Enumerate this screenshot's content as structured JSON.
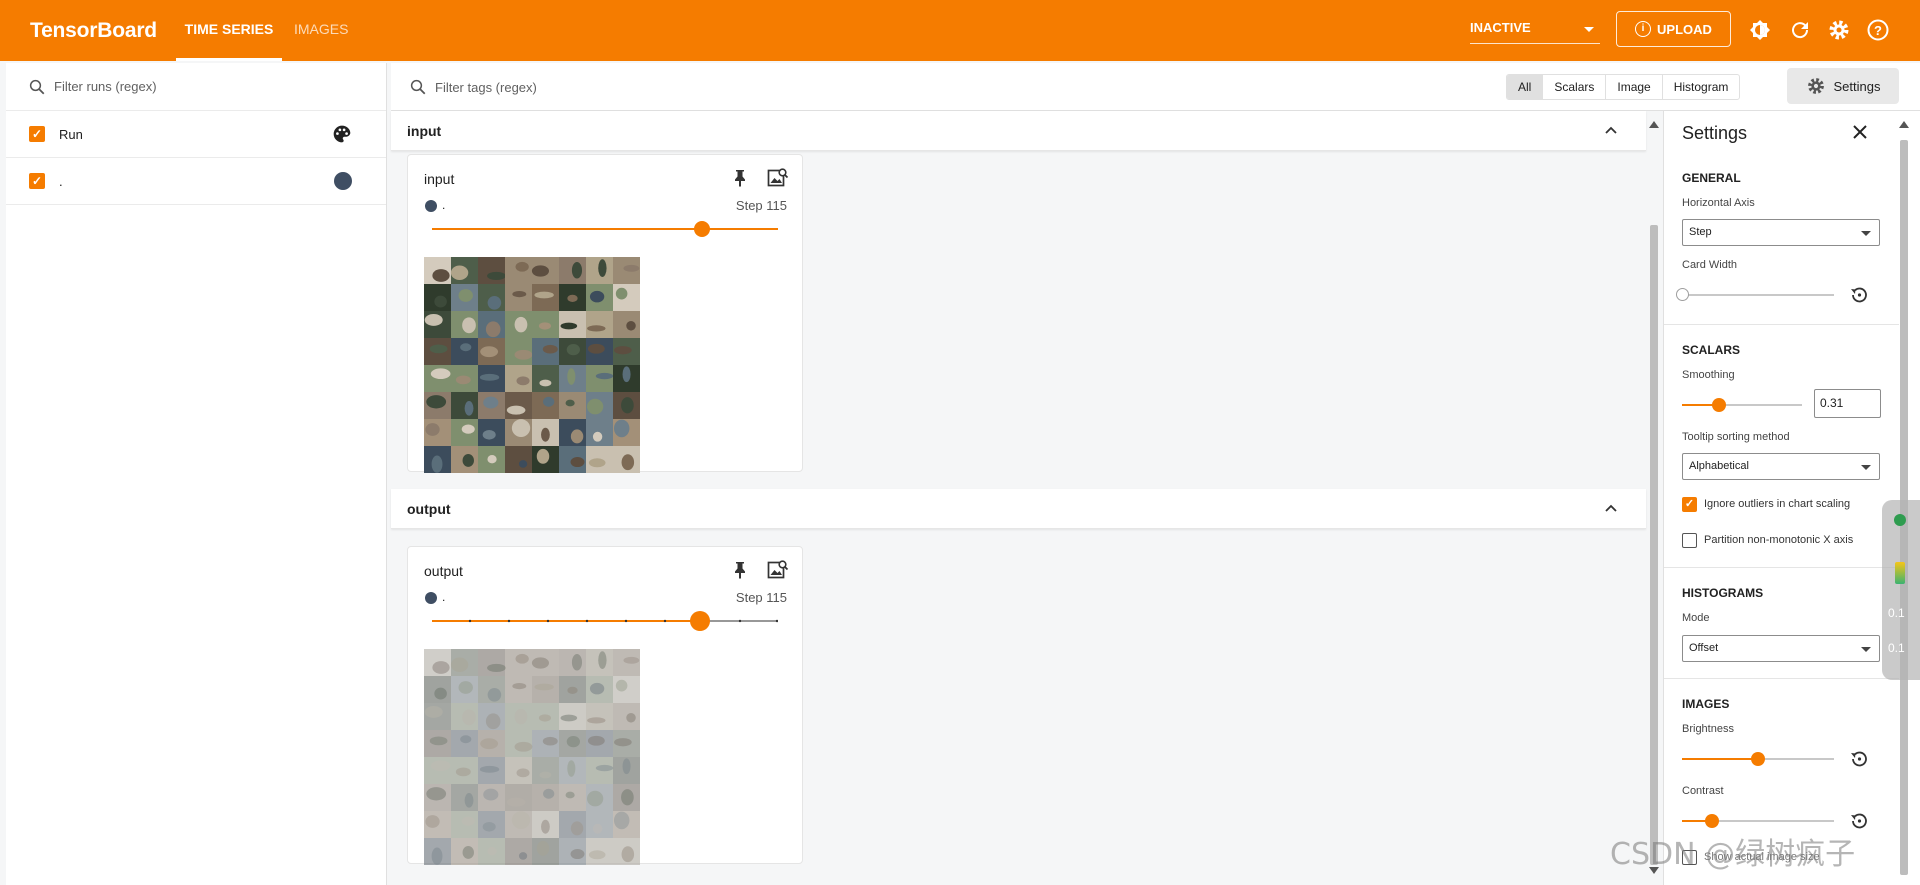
{
  "app": {
    "title": "TensorBoard"
  },
  "tabs": [
    {
      "label": "TIME SERIES"
    },
    {
      "label": "IMAGES"
    }
  ],
  "header": {
    "status_value": "INACTIVE",
    "upload_label": "UPLOAD"
  },
  "runs_panel": {
    "filter_placeholder": "Filter runs (regex)",
    "runs": [
      {
        "label": "Run",
        "checked": true
      },
      {
        "label": ".",
        "checked": true,
        "color": "#3f4e63"
      }
    ]
  },
  "main": {
    "filter_placeholder": "Filter tags (regex)",
    "type_buttons": [
      "All",
      "Scalars",
      "Image",
      "Histogram"
    ],
    "selected_type": "All",
    "settings_label": "Settings",
    "groups": [
      {
        "title": "input",
        "card": {
          "title": "input",
          "run": ".",
          "step": "Step 115",
          "slider_fraction": 0.78
        }
      },
      {
        "title": "output",
        "card": {
          "title": "output",
          "run": ".",
          "step": "Step 115",
          "slider_fraction": 0.78
        }
      }
    ]
  },
  "settings": {
    "title": "Settings",
    "general": {
      "heading": "GENERAL",
      "horizontal_axis_label": "Horizontal Axis",
      "horizontal_axis_value": "Step",
      "card_width_label": "Card Width"
    },
    "scalars": {
      "heading": "SCALARS",
      "smoothing_label": "Smoothing",
      "smoothing_value": "0.31",
      "tooltip_label": "Tooltip sorting method",
      "tooltip_value": "Alphabetical",
      "ignore_outliers_label": "Ignore outliers in chart scaling",
      "ignore_outliers_checked": true,
      "partition_label": "Partition non-monotonic X axis",
      "partition_checked": false
    },
    "histograms": {
      "heading": "HISTOGRAMS",
      "mode_label": "Mode",
      "mode_value": "Offset"
    },
    "images": {
      "heading": "IMAGES",
      "brightness_label": "Brightness",
      "contrast_label": "Contrast",
      "actual_size_label": "Show actual image size"
    }
  },
  "overlay": {
    "watermark": "CSDN @绿树疯子",
    "net_up": "0.1",
    "net_down": "0.1"
  }
}
